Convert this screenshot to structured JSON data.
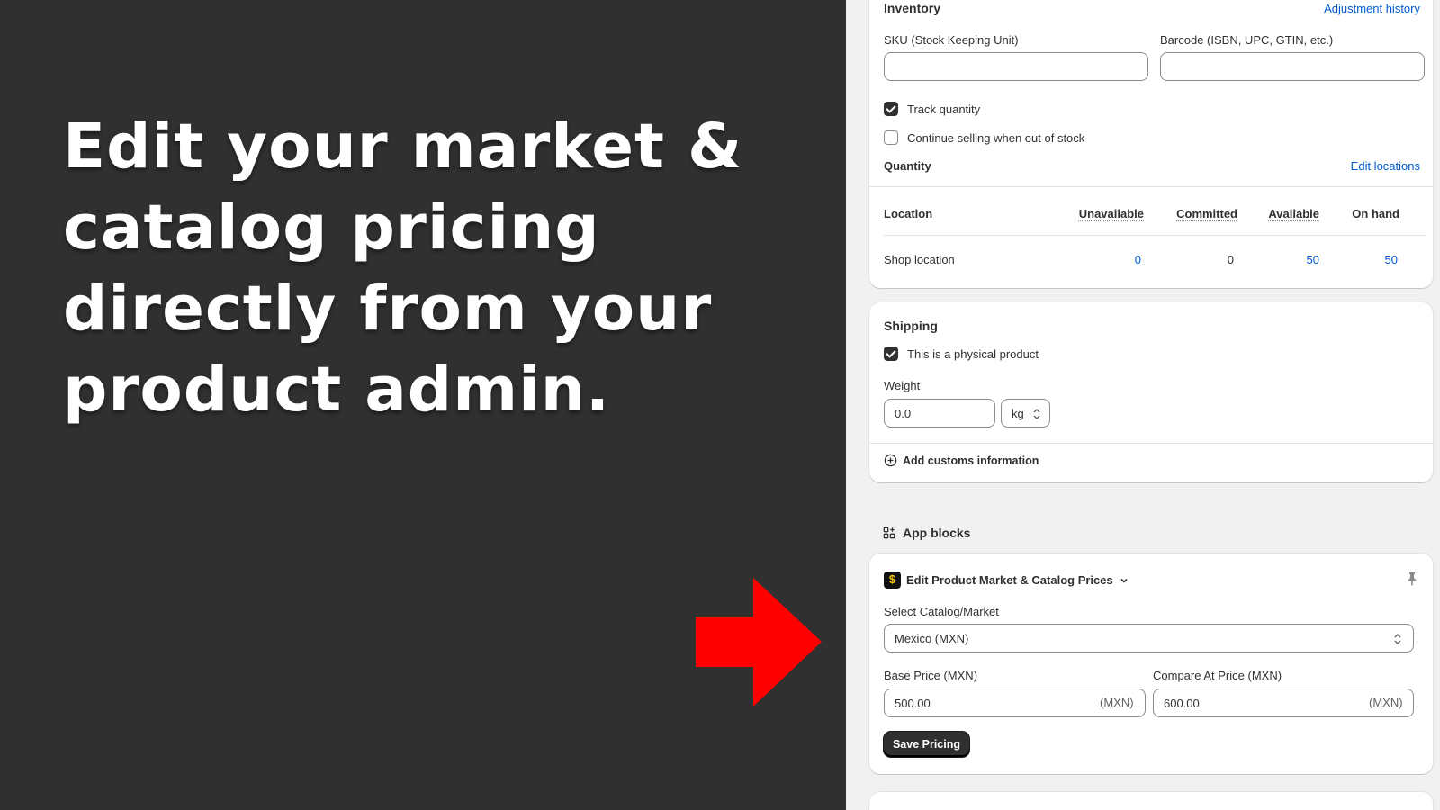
{
  "headline": {
    "lines": [
      "Edit your market &",
      "catalog pricing",
      "directly from your",
      "product admin."
    ]
  },
  "arrow": {
    "color": "#ff0000",
    "icon": "right-arrow-icon"
  },
  "inventory": {
    "title": "Inventory",
    "adjustment_history": "Adjustment history",
    "sku_label": "SKU (Stock Keeping Unit)",
    "sku_value": "",
    "barcode_label": "Barcode (ISBN, UPC, GTIN, etc.)",
    "barcode_value": "",
    "track_quantity": {
      "label": "Track quantity",
      "checked": true
    },
    "continue_selling": {
      "label": "Continue selling when out of stock",
      "checked": false
    },
    "quantity_title": "Quantity",
    "edit_locations": "Edit locations",
    "table": {
      "headers": [
        "Location",
        "Unavailable",
        "Committed",
        "Available",
        "On hand"
      ],
      "rows": [
        {
          "location": "Shop location",
          "unavailable": "0",
          "committed": "0",
          "available": "50",
          "on_hand": "50"
        }
      ]
    }
  },
  "shipping": {
    "title": "Shipping",
    "physical_product": {
      "label": "This is a physical product",
      "checked": true
    },
    "weight_label": "Weight",
    "weight_value": "0.0",
    "weight_unit": "kg",
    "add_customs": "Add customs information"
  },
  "app_blocks": {
    "title": "App blocks",
    "block": {
      "title": "Edit Product Market & Catalog Prices",
      "select_label": "Select Catalog/Market",
      "select_value": "Mexico (MXN)",
      "base_price_label": "Base Price (MXN)",
      "base_price_value": "500.00",
      "base_price_suffix": "(MXN)",
      "compare_price_label": "Compare At Price (MXN)",
      "compare_price_value": "600.00",
      "compare_price_suffix": "(MXN)",
      "save_button": "Save Pricing"
    }
  },
  "colors": {
    "accent": "#005bd3",
    "dark": "#303030",
    "arrow": "#ff0000"
  }
}
